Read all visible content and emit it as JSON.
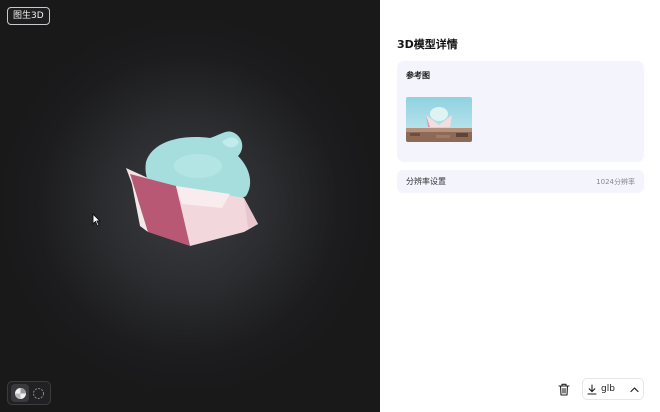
{
  "viewport": {
    "badge": "图生3D",
    "render_modes": [
      {
        "icon": "solid-sphere-icon",
        "active": true
      },
      {
        "icon": "wireframe-sphere-icon",
        "active": false
      }
    ]
  },
  "panel": {
    "title": "3D模型详情",
    "reference": {
      "label": "参考图"
    },
    "resolution": {
      "label": "分辨率设置",
      "value": "1024分辨率"
    },
    "footer": {
      "delete_icon": "trash-icon",
      "download_label": "glb",
      "download_icon": "download-icon",
      "expand_icon": "chevron-up-icon"
    }
  }
}
